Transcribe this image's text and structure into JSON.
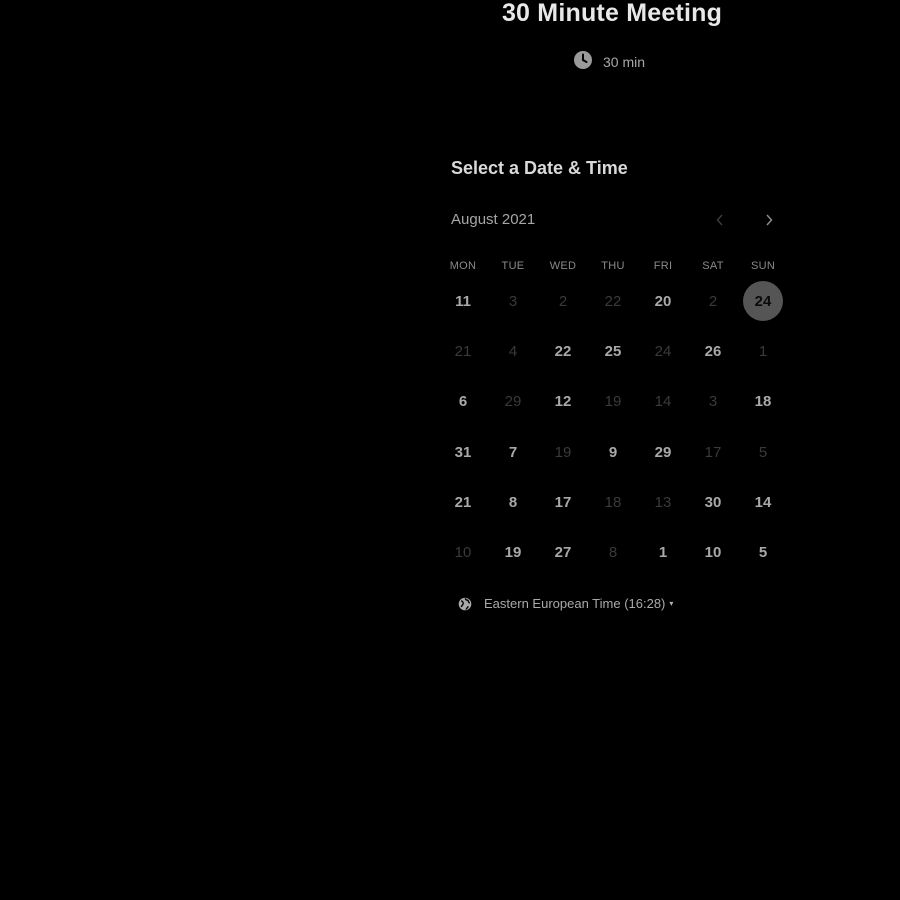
{
  "event": {
    "title": "30 Minute Meeting",
    "duration": "30 min"
  },
  "calendar": {
    "heading": "Select a Date & Time",
    "month": "August 2021",
    "prev_icon": "chevron-left-icon",
    "next_icon": "chevron-right-icon",
    "weekdays": [
      "MON",
      "TUE",
      "WED",
      "THU",
      "FRI",
      "SAT",
      "SUN"
    ],
    "weeks": [
      [
        {
          "day": "11",
          "available": true
        },
        {
          "day": "3",
          "available": false
        },
        {
          "day": "2",
          "available": false
        },
        {
          "day": "22",
          "available": false
        },
        {
          "day": "20",
          "available": true
        },
        {
          "day": "2",
          "available": false
        },
        {
          "day": "24",
          "available": true,
          "selected": true
        }
      ],
      [
        {
          "day": "21",
          "available": false
        },
        {
          "day": "4",
          "available": false
        },
        {
          "day": "22",
          "available": true
        },
        {
          "day": "25",
          "available": true
        },
        {
          "day": "24",
          "available": false
        },
        {
          "day": "26",
          "available": true
        },
        {
          "day": "1",
          "available": false
        }
      ],
      [
        {
          "day": "6",
          "available": true
        },
        {
          "day": "29",
          "available": false
        },
        {
          "day": "12",
          "available": true
        },
        {
          "day": "19",
          "available": false
        },
        {
          "day": "14",
          "available": false
        },
        {
          "day": "3",
          "available": false
        },
        {
          "day": "18",
          "available": true
        }
      ],
      [
        {
          "day": "31",
          "available": true
        },
        {
          "day": "7",
          "available": true
        },
        {
          "day": "19",
          "available": false
        },
        {
          "day": "9",
          "available": true
        },
        {
          "day": "29",
          "available": true
        },
        {
          "day": "17",
          "available": false
        },
        {
          "day": "5",
          "available": false
        }
      ],
      [
        {
          "day": "21",
          "available": true
        },
        {
          "day": "8",
          "available": true
        },
        {
          "day": "17",
          "available": true
        },
        {
          "day": "18",
          "available": false
        },
        {
          "day": "13",
          "available": false
        },
        {
          "day": "30",
          "available": true
        },
        {
          "day": "14",
          "available": true
        }
      ],
      [
        {
          "day": "10",
          "available": false
        },
        {
          "day": "19",
          "available": true
        },
        {
          "day": "27",
          "available": true
        },
        {
          "day": "8",
          "available": false
        },
        {
          "day": "1",
          "available": true
        },
        {
          "day": "10",
          "available": true
        },
        {
          "day": "5",
          "available": true
        }
      ]
    ]
  },
  "timezone": {
    "label": "Eastern European Time (16:28)",
    "icon": "globe-icon",
    "caret": "▾"
  },
  "colors": {
    "background": "#000000",
    "selected_day_bg": "#555555",
    "available_text": "#a9a9a9",
    "unavailable_text": "#3a3a3a"
  }
}
